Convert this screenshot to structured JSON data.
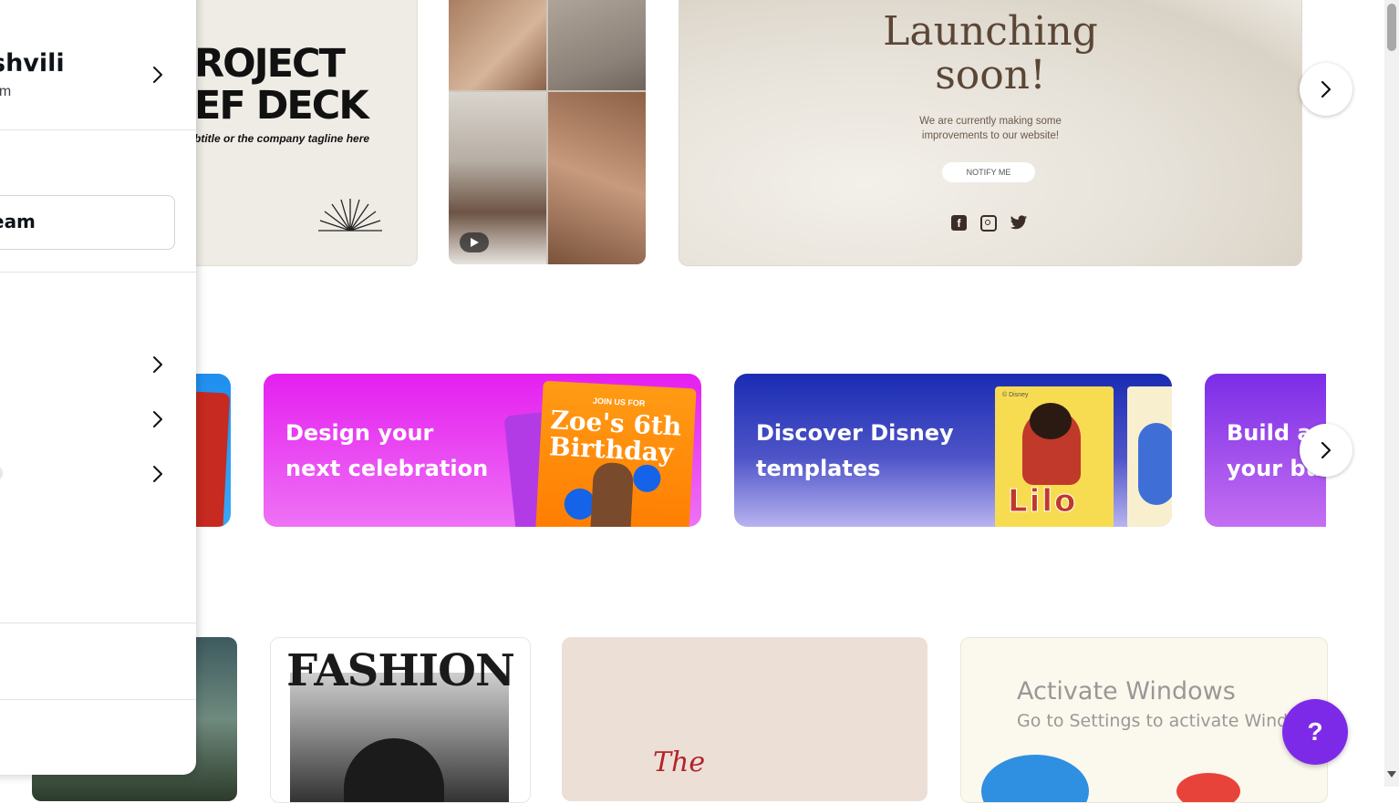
{
  "account": {
    "name_fragment": "shvili",
    "email_fragment": "om"
  },
  "team_button": {
    "label_fragment": "eam"
  },
  "templates_row1": {
    "project_deck": {
      "title_line1": "ROJECT",
      "title_line2": "EF DECK",
      "subtitle": "btitle or the company tagline here"
    },
    "launching": {
      "title_line1": "Launching",
      "title_line2": "soon!",
      "body_line1": "We are currently making some",
      "body_line2": "improvements to our website!",
      "button": "NOTIFY ME"
    }
  },
  "banners": {
    "celebration": {
      "line1": "Design your",
      "line2": "next celebration",
      "card_top": "JOIN US FOR",
      "card_line1": "Zoe's 6th",
      "card_line2": "Birthday"
    },
    "disney": {
      "line1": "Discover Disney",
      "line2": "templates",
      "copyright": "© Disney",
      "lilo_text": "Lilo"
    },
    "business": {
      "line1": "Build ar",
      "line2": "your bus"
    }
  },
  "templates_row3": {
    "fashion": {
      "title": "FASHION"
    },
    "script": {
      "text": "The"
    }
  },
  "watermark": {
    "title": "Activate Windows",
    "subtitle": "Go to Settings to activate Windows."
  },
  "help": {
    "label": "?"
  },
  "colors": {
    "accent_purple": "#7d2ae8",
    "celebration_pink": "#e619f0",
    "disney_blue": "#1f2fb5",
    "business_purple": "#8b3df0"
  }
}
